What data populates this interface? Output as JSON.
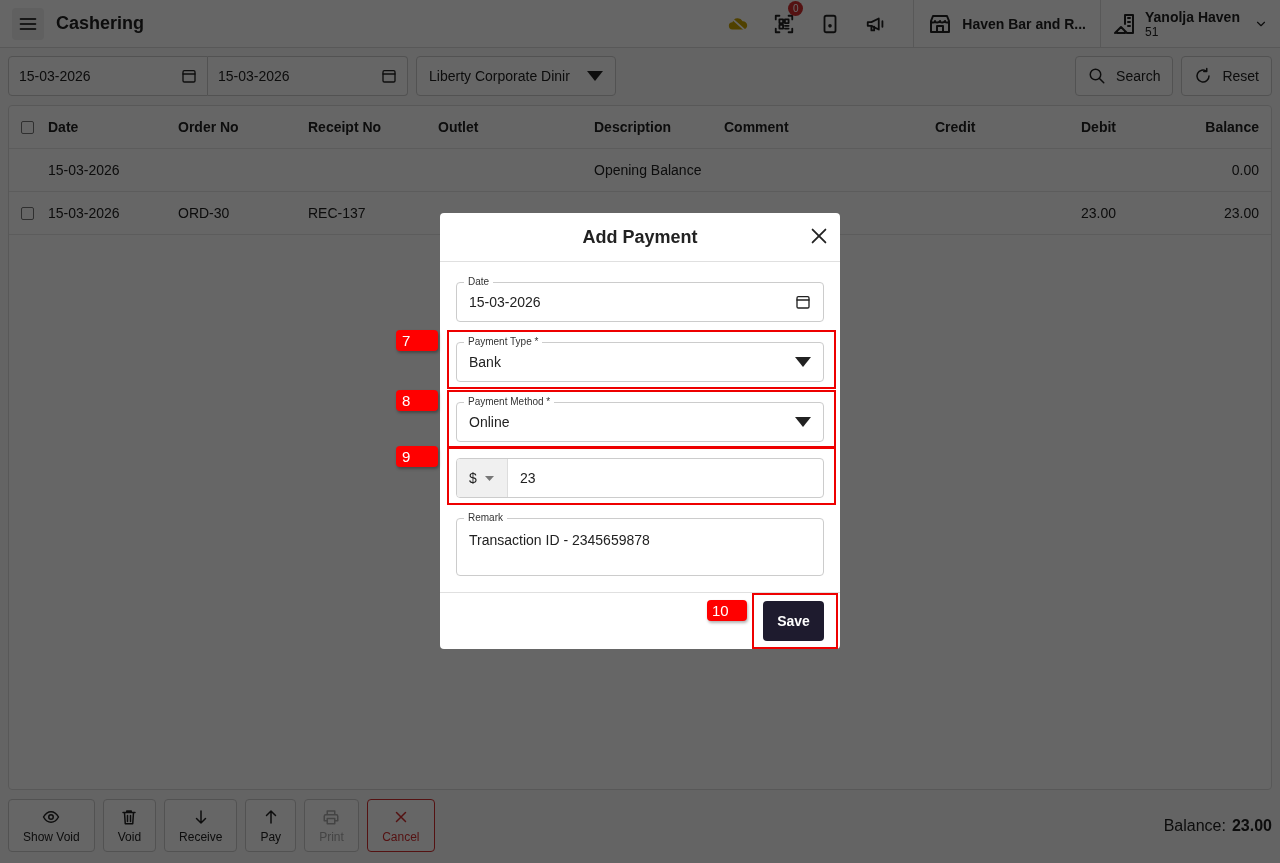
{
  "app_bar": {
    "title": "Cashering",
    "notification_badge": "0",
    "outlet": "Haven Bar and R...",
    "property": {
      "name": "Yanolja Haven",
      "number": "51"
    }
  },
  "filters": {
    "from_date": "15-03-2026",
    "to_date": "15-03-2026",
    "customer": "Liberty Corporate Dinir",
    "buttons": [
      "Search",
      "Reset"
    ]
  },
  "table": {
    "columns": [
      "Date",
      "Order No",
      "Receipt No",
      "Outlet",
      "Description",
      "Comment",
      "Credit",
      "Debit",
      "Balance"
    ],
    "header_checkbox": {
      "checked": false
    },
    "rows": [
      {
        "date": "15-03-2026",
        "description": "Opening Balance",
        "balance": "0.00"
      },
      {
        "checked": false,
        "date": "15-03-2026",
        "order_no": "ORD-30",
        "receipt_no": "REC-137",
        "debit": "23.00",
        "balance": "23.00"
      }
    ]
  },
  "actions": [
    {
      "label": "Show Void",
      "kind": "default",
      "disabled": false
    },
    {
      "label": "Void",
      "kind": "default",
      "disabled": false
    },
    {
      "label": "Receive",
      "kind": "default",
      "disabled": false
    },
    {
      "label": "Pay",
      "kind": "default",
      "disabled": false
    },
    {
      "label": "Print",
      "kind": "default",
      "disabled": true
    },
    {
      "label": "Cancel",
      "kind": "danger",
      "disabled": false
    }
  ],
  "balance": {
    "label": "Balance:",
    "value": "23.00"
  },
  "dialog": {
    "title": "Add Payment",
    "date": {
      "label": "Date",
      "value": "15-03-2026"
    },
    "payment_type": {
      "label": "Payment Type *",
      "value": "Bank",
      "callout": "7"
    },
    "payment_method": {
      "label": "Payment Method *",
      "value": "Online",
      "callout": "8"
    },
    "amount": {
      "currency": "$",
      "value": "23",
      "callout": "9"
    },
    "remark": {
      "label": "Remark",
      "value": "Transaction ID - 2345659878"
    },
    "save": {
      "label": "Save",
      "callout": "10"
    }
  }
}
